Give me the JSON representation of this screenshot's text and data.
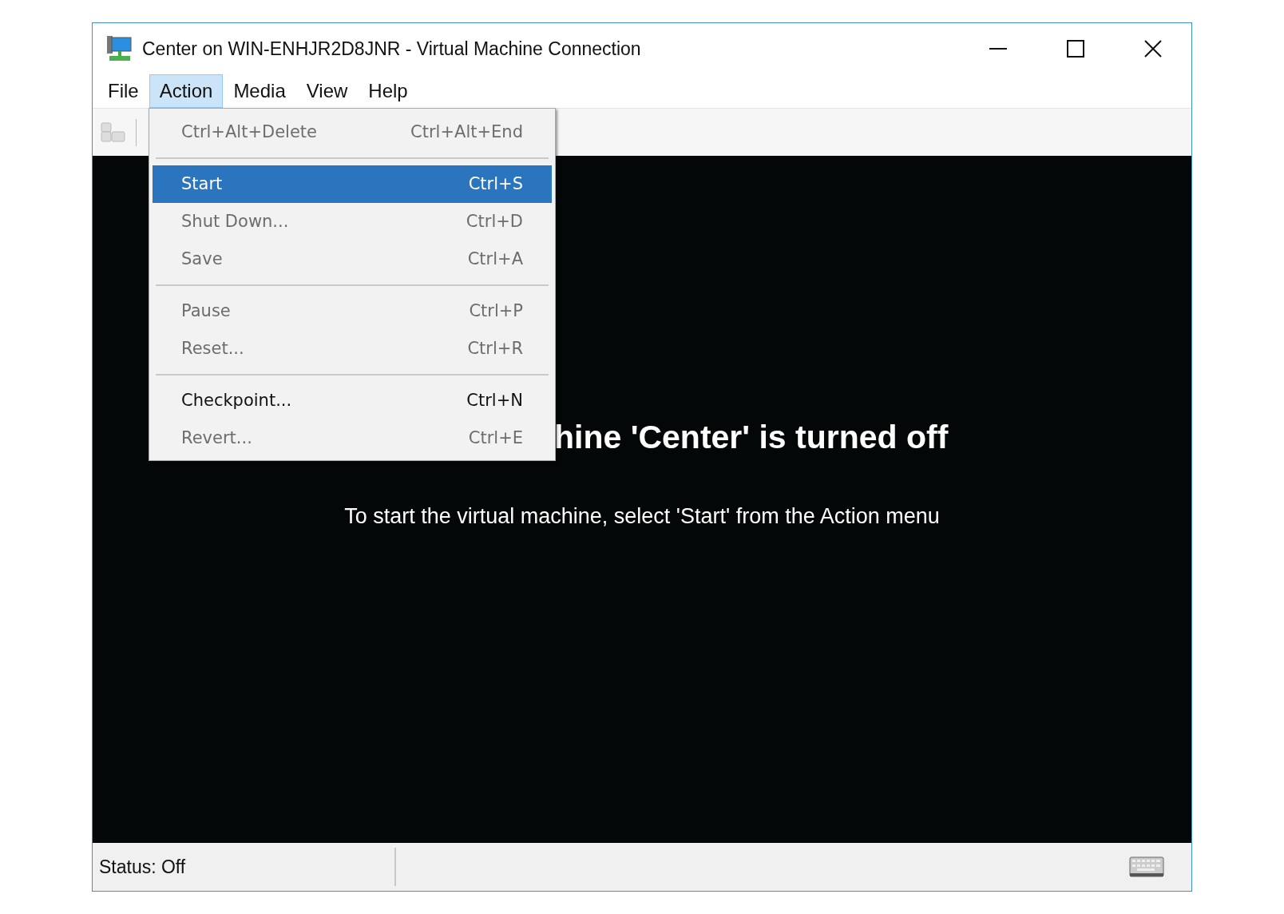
{
  "window": {
    "title": "Center on WIN-ENHJR2D8JNR - Virtual Machine Connection"
  },
  "menu_bar": [
    {
      "label": "File",
      "selected": false
    },
    {
      "label": "Action",
      "selected": true
    },
    {
      "label": "Media",
      "selected": false
    },
    {
      "label": "View",
      "selected": false
    },
    {
      "label": "Help",
      "selected": false
    }
  ],
  "action_menu": {
    "groups": [
      [
        {
          "label": "Ctrl+Alt+Delete",
          "shortcut": "Ctrl+Alt+End",
          "disabled": true,
          "selected": false
        }
      ],
      [
        {
          "label": "Start",
          "shortcut": "Ctrl+S",
          "disabled": false,
          "selected": true
        },
        {
          "label": "Shut Down...",
          "shortcut": "Ctrl+D",
          "disabled": true,
          "selected": false
        },
        {
          "label": "Save",
          "shortcut": "Ctrl+A",
          "disabled": true,
          "selected": false
        }
      ],
      [
        {
          "label": "Pause",
          "shortcut": "Ctrl+P",
          "disabled": true,
          "selected": false
        },
        {
          "label": "Reset...",
          "shortcut": "Ctrl+R",
          "disabled": true,
          "selected": false
        }
      ],
      [
        {
          "label": "Checkpoint...",
          "shortcut": "Ctrl+N",
          "disabled": false,
          "selected": false
        },
        {
          "label": "Revert...",
          "shortcut": "Ctrl+E",
          "disabled": true,
          "selected": false
        }
      ]
    ]
  },
  "screen": {
    "heading": "hine 'Center' is turned off",
    "message": "To start the virtual machine, select 'Start' from the Action menu"
  },
  "status_bar": {
    "status": "Status: Off"
  }
}
